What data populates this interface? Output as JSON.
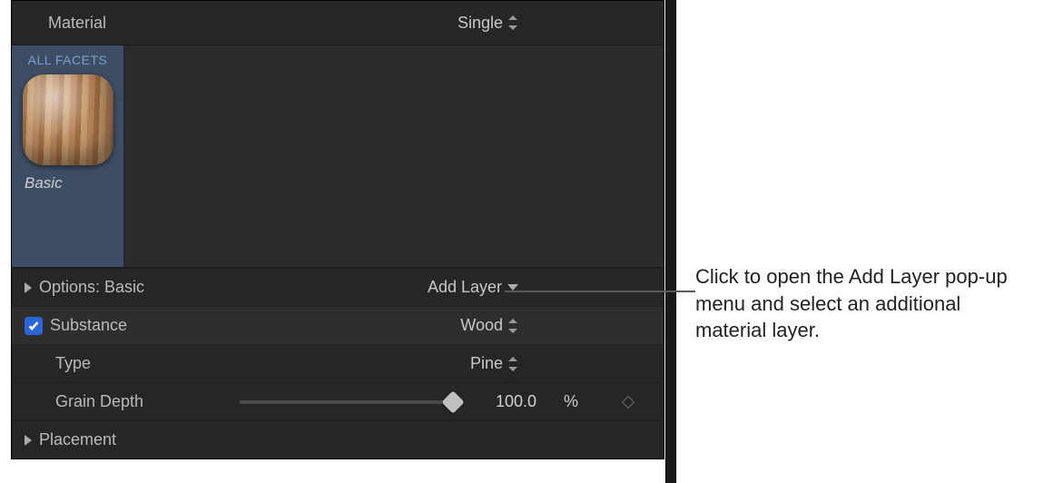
{
  "header": {
    "label": "Material",
    "dropdown_value": "Single"
  },
  "facets": {
    "tab_label": "ALL FACETS",
    "thumb_caption": "Basic"
  },
  "options_row": {
    "label": "Options: Basic",
    "add_layer_label": "Add Layer"
  },
  "substance_row": {
    "label": "Substance",
    "value": "Wood"
  },
  "type_row": {
    "label": "Type",
    "value": "Pine"
  },
  "grain_row": {
    "label": "Grain Depth",
    "value": "100.0",
    "unit": "%",
    "slider_pct": 100
  },
  "placement_row": {
    "label": "Placement"
  },
  "callout": {
    "text": "Click to open the Add Layer pop-up menu and select an additional material layer."
  }
}
